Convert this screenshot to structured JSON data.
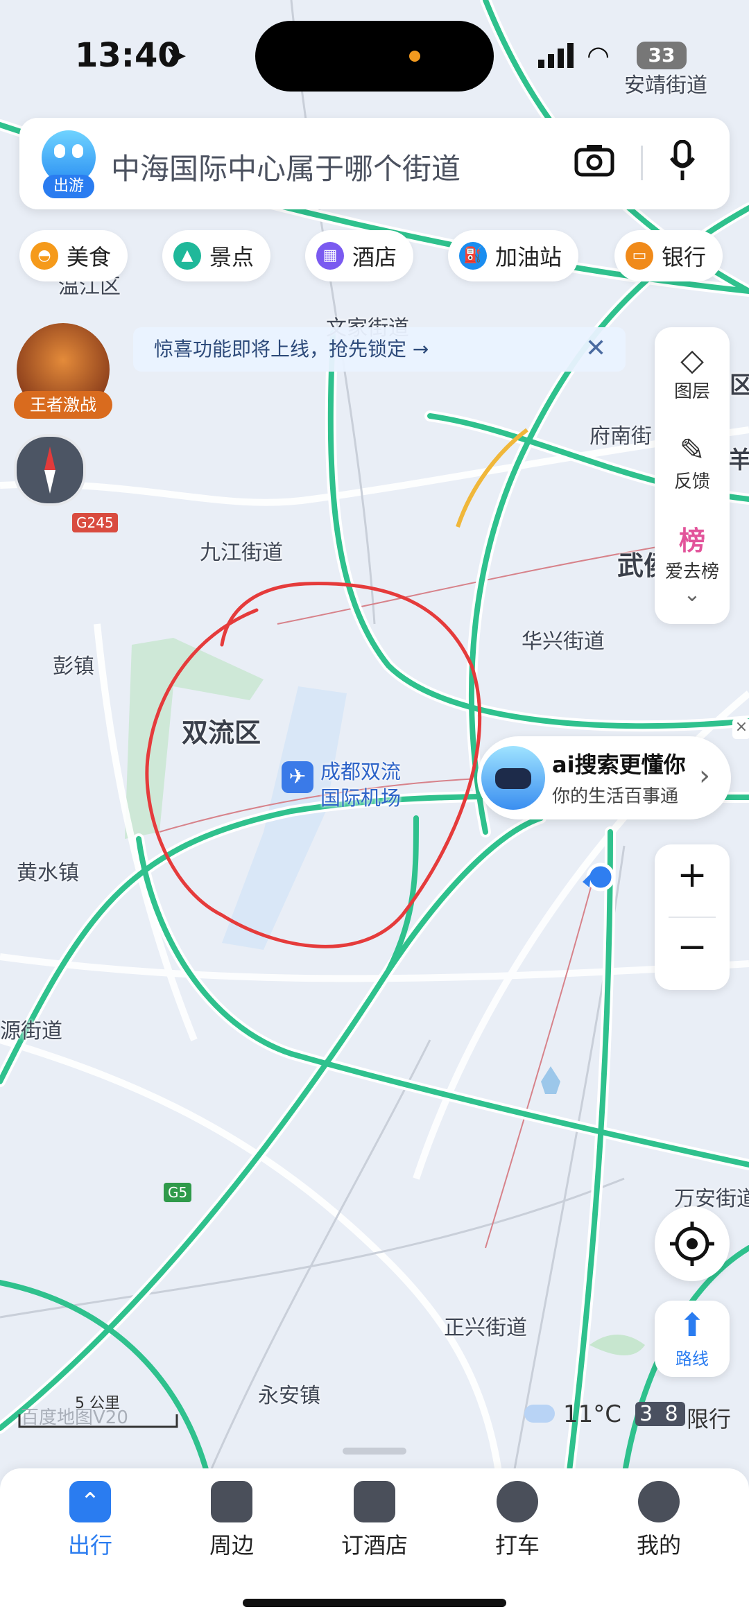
{
  "status_bar": {
    "time": "13:40",
    "battery": "33"
  },
  "search": {
    "query": "中海国际中心属于哪个街道",
    "avatar_badge": "出游"
  },
  "categories": [
    {
      "label": "美食",
      "color": "#f59a1b"
    },
    {
      "label": "景点",
      "color": "#1fb89a"
    },
    {
      "label": "酒店",
      "color": "#7a5af0"
    },
    {
      "label": "加油站",
      "color": "#1a8df0"
    },
    {
      "label": "银行",
      "color": "#f08a1a"
    }
  ],
  "banner": {
    "text": "惊喜功能即将上线，抢先锁定 →"
  },
  "game_badge": "王者激战",
  "tools": {
    "layers": "图层",
    "feedback": "反馈",
    "rank_icon": "榜",
    "rank": "爱去榜"
  },
  "ai": {
    "title": "ai搜索更懂你",
    "subtitle": "你的生活百事通"
  },
  "route_label": "路线",
  "map": {
    "labels": {
      "anjing": "安靖街道",
      "wenjiang": "温江区",
      "wenjia": "文家街道",
      "funan": "府南街",
      "jiujiang": "九江街道",
      "wu": "武侯",
      "huaxing": "华兴街道",
      "pengzhen": "彭镇",
      "shuangliu": "双流区",
      "airport_line1": "成都双流",
      "airport_line2": "国际机场",
      "huangshui": "黄水镇",
      "yuan": "源街道",
      "wanan": "万安街道",
      "zhengxing": "正兴街道",
      "yongan": "永安镇",
      "right_edge_a": "区",
      "right_edge_b": "羊"
    },
    "highways": {
      "g245": "G245",
      "g5": "G5"
    },
    "scale": "5 公里",
    "watermark": "百度地图V20",
    "weather": "11°C",
    "restriction_nums": "3 8",
    "restriction": "限行"
  },
  "tabs": [
    {
      "label": "出行",
      "active": true
    },
    {
      "label": "周边",
      "active": false
    },
    {
      "label": "订酒店",
      "active": false
    },
    {
      "label": "打车",
      "active": false
    },
    {
      "label": "我的",
      "active": false
    }
  ]
}
